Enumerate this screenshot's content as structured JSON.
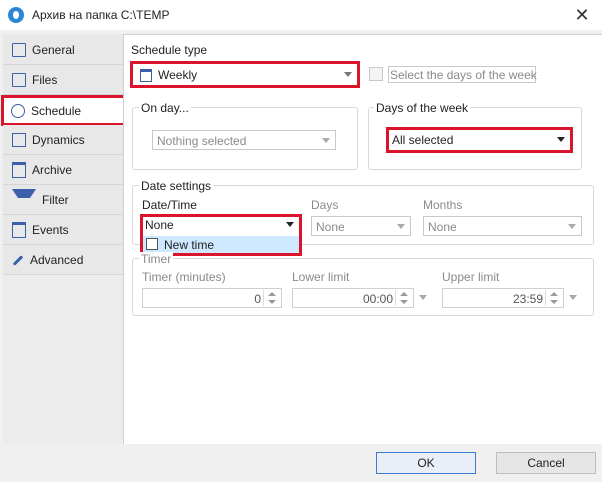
{
  "window": {
    "title": "Архив на папка C:\\TEMP",
    "close_glyph": "✕"
  },
  "tabs": [
    {
      "label": "General",
      "icon": "monitor-icon"
    },
    {
      "label": "Files",
      "icon": "files-icon"
    },
    {
      "label": "Schedule",
      "icon": "clock-icon"
    },
    {
      "label": "Dynamics",
      "icon": "bars-icon"
    },
    {
      "label": "Archive",
      "icon": "archive-icon"
    },
    {
      "label": "Filter",
      "icon": "filter-icon"
    },
    {
      "label": "Events",
      "icon": "calendar-icon"
    },
    {
      "label": "Advanced",
      "icon": "wrench-icon"
    }
  ],
  "schedule": {
    "type_label": "Schedule type",
    "type_value": "Weekly",
    "select_days_label": "Select the days of the week",
    "on_day": {
      "title": "On day...",
      "value": "Nothing selected"
    },
    "days_of_week": {
      "title": "Days of the week",
      "value": "All selected"
    },
    "date_settings": {
      "title": "Date settings",
      "datetime_label": "Date/Time",
      "datetime_value": "None",
      "dropdown_option": "New time",
      "days_label": "Days",
      "days_value": "None",
      "months_label": "Months",
      "months_value": "None"
    },
    "timer": {
      "title": "Timer",
      "timer_label": "Timer (minutes)",
      "timer_value": "0",
      "lower_label": "Lower limit",
      "lower_value": "00:00",
      "upper_label": "Upper limit",
      "upper_value": "23:59"
    }
  },
  "footer": {
    "ok_label": "OK",
    "cancel_label": "Cancel"
  },
  "colors": {
    "highlight": "#d9142b",
    "accent": "#3b5fa8",
    "selection": "#cde8ff"
  }
}
